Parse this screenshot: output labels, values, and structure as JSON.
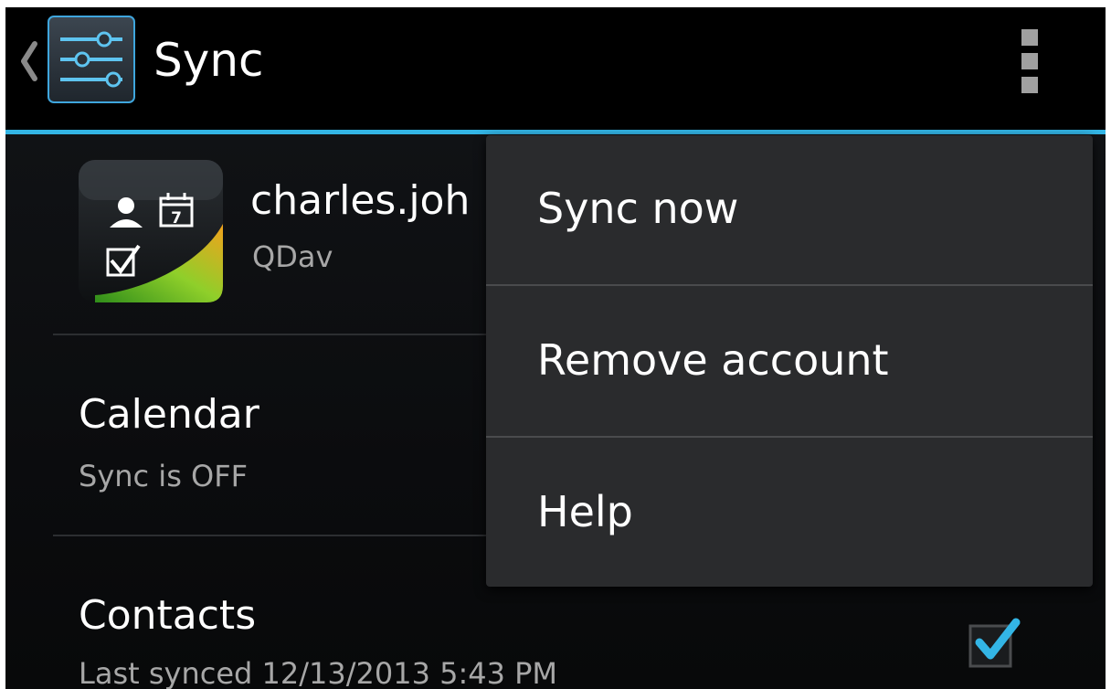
{
  "action_bar": {
    "title": "Sync",
    "up_icon": "chevron-left-icon",
    "app_icon": "settings-sliders-icon",
    "overflow_icon": "overflow-menu-icon"
  },
  "account": {
    "name": "charles.joh",
    "type": "QDav",
    "icon": "qdav-account-icon",
    "icon_calendar_day": "7"
  },
  "sync_items": [
    {
      "title": "Calendar",
      "summary": "Sync is OFF",
      "checked": false
    },
    {
      "title": "Contacts",
      "summary": "Last synced 12/13/2013 5:43 PM",
      "checked": true
    }
  ],
  "menu": {
    "items": [
      {
        "label": "Sync now"
      },
      {
        "label": "Remove account"
      },
      {
        "label": "Help"
      }
    ]
  },
  "colors": {
    "accent": "#33b5e5",
    "background": "#000000",
    "menu_background": "#2a2b2d",
    "primary_text": "#ffffff",
    "secondary_text": "#a7a7a7"
  }
}
